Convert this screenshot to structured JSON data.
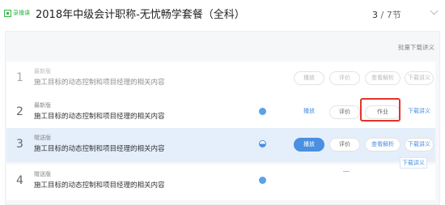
{
  "header": {
    "tag": "录播课",
    "title": "2018年中级会计职称-无忧畅学套餐（全科）",
    "counter_current": "3",
    "counter_rest": " / 7节"
  },
  "toolbar": {
    "download_all": "批量下载讲义"
  },
  "lessons": [
    {
      "number": "1",
      "badge": "最新版",
      "title": "施工目标的动态控制和项目经理的相关内容",
      "buttons": {
        "play": "播放",
        "rate": "评价",
        "third": "查看解析",
        "download": "下载讲义"
      }
    },
    {
      "number": "2",
      "badge": "最新版",
      "title": "施工目标的动态控制和项目经理的相关内容",
      "buttons": {
        "play": "播放",
        "rate": "评价",
        "third": "作业",
        "download": "下载讲义"
      }
    },
    {
      "number": "3",
      "badge": "赠送版",
      "title": "施工目标的动态控制和项目经理的相关内容",
      "buttons": {
        "play": "播放",
        "rate": "评价",
        "third": "查看解析",
        "download": "下载讲义"
      }
    },
    {
      "number": "4",
      "badge": "赠送版",
      "title": "施工目标的动态控制和项目经理的相关内容"
    }
  ],
  "tooltip": "下载讲义",
  "colors": {
    "accent": "#4a8fe0",
    "highlight": "#e5332a",
    "tag_green": "#3bb54a"
  }
}
